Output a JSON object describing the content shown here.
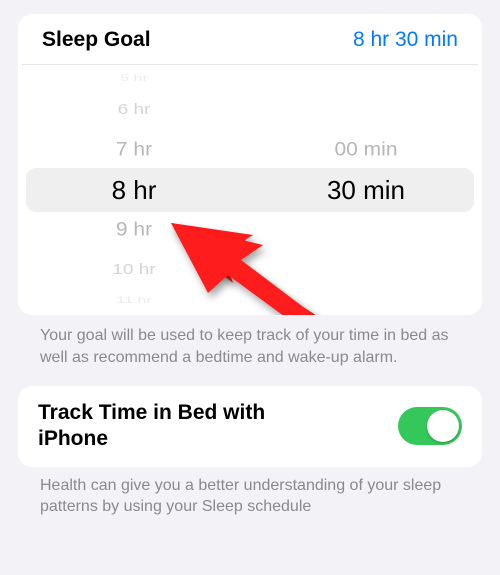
{
  "sleep_goal": {
    "title": "Sleep Goal",
    "value": "8 hr 30 min",
    "picker": {
      "hours": {
        "above": [
          "5 hr",
          "6 hr",
          "7 hr"
        ],
        "selected": "8 hr",
        "below": [
          "9 hr",
          "10 hr",
          "11 hr"
        ]
      },
      "minutes": {
        "above": [
          "00 min"
        ],
        "selected": "30 min",
        "below": []
      }
    },
    "caption": "Your goal will be used to keep track of your time in bed as well as recommend a bedtime and wake-up alarm."
  },
  "track": {
    "label": "Track Time in Bed with iPhone",
    "on": true,
    "caption": "Health can give you a better understanding of your sleep patterns by using your Sleep schedule"
  }
}
